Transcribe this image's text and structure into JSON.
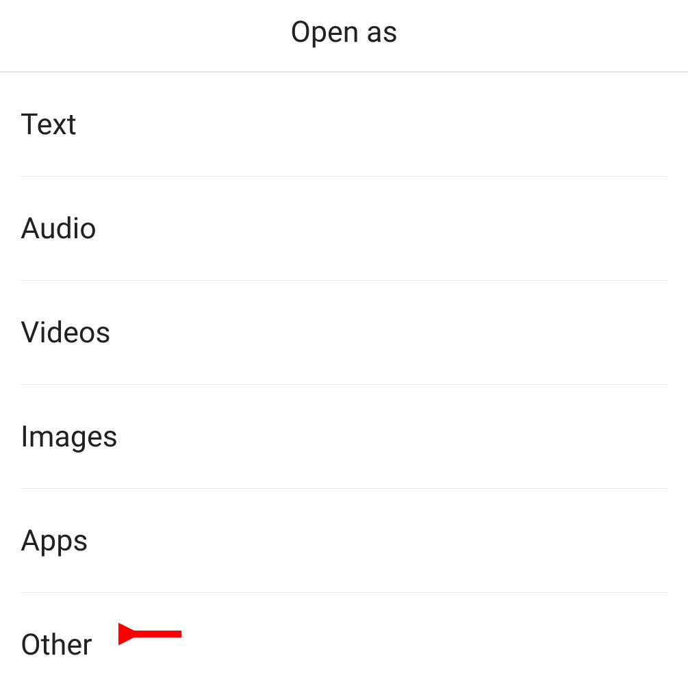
{
  "header": {
    "title": "Open as"
  },
  "list": {
    "items": [
      {
        "label": "Text"
      },
      {
        "label": "Audio"
      },
      {
        "label": "Videos"
      },
      {
        "label": "Images"
      },
      {
        "label": "Apps"
      },
      {
        "label": "Other"
      }
    ]
  },
  "annotation": {
    "arrow": {
      "color": "#ff0000"
    }
  }
}
